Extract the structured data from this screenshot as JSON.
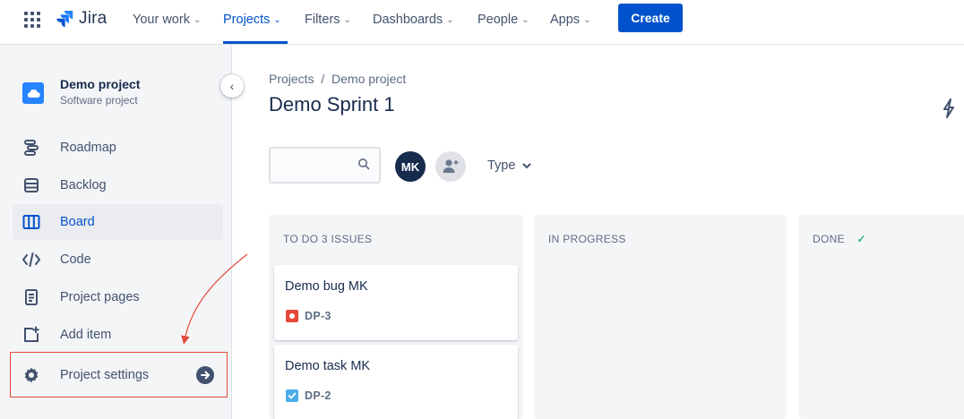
{
  "topnav": {
    "logo_text": "Jira",
    "items": [
      {
        "label": "Your work"
      },
      {
        "label": "Projects"
      },
      {
        "label": "Filters"
      },
      {
        "label": "Dashboards"
      },
      {
        "label": "People"
      },
      {
        "label": "Apps"
      }
    ],
    "active_item": "Projects",
    "create_label": "Create",
    "accent_color": "#0052CC"
  },
  "sidebar": {
    "project_name": "Demo project",
    "project_type": "Software project",
    "items": [
      {
        "label": "Roadmap",
        "icon": "roadmap-icon"
      },
      {
        "label": "Backlog",
        "icon": "backlog-icon"
      },
      {
        "label": "Board",
        "icon": "board-icon",
        "selected": true
      },
      {
        "label": "Code",
        "icon": "code-icon"
      },
      {
        "label": "Project pages",
        "icon": "pages-icon"
      },
      {
        "label": "Add item",
        "icon": "add-item-icon"
      },
      {
        "label": "Project settings",
        "icon": "gear-icon",
        "highlighted": true
      }
    ]
  },
  "main": {
    "breadcrumb": "Projects  /  Demo project",
    "title": "Demo Sprint 1",
    "user_initials": "MK",
    "type_filter": "Type",
    "columns": [
      {
        "title": "TO DO 3 ISSUES",
        "cards": [
          {
            "title": "Demo bug MK",
            "key": "DP-3",
            "type": "bug"
          },
          {
            "title": "Demo task MK",
            "key": "DP-2",
            "type": "task"
          }
        ]
      },
      {
        "title": "IN PROGRESS",
        "cards": []
      },
      {
        "title": "DONE",
        "done_check": "✓",
        "cards": []
      }
    ]
  },
  "colors": {
    "bug": "#E5493A",
    "task": "#4BADE8",
    "done_check": "#36B37E",
    "annotation": "#E5493A"
  }
}
